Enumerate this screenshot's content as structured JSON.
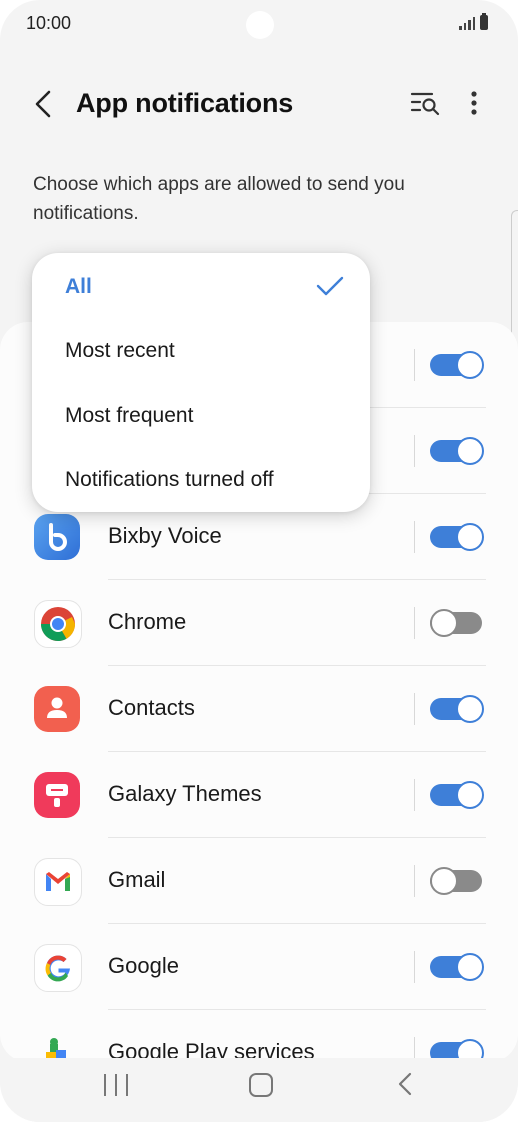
{
  "status_bar": {
    "time": "10:00"
  },
  "header": {
    "title": "App notifications"
  },
  "description": "Choose which apps are allowed to send you notifications.",
  "dropdown": {
    "items": [
      {
        "label": "All",
        "selected": true
      },
      {
        "label": "Most recent",
        "selected": false
      },
      {
        "label": "Most frequent",
        "selected": false
      },
      {
        "label": "Notifications turned off",
        "selected": false
      }
    ]
  },
  "apps": [
    {
      "name": "",
      "enabled": true
    },
    {
      "name": "",
      "enabled": true
    },
    {
      "name": "Bixby Voice",
      "enabled": true,
      "icon": "bixby-voice-icon"
    },
    {
      "name": "Chrome",
      "enabled": false,
      "icon": "chrome-icon"
    },
    {
      "name": "Contacts",
      "enabled": true,
      "icon": "contacts-icon"
    },
    {
      "name": "Galaxy Themes",
      "enabled": true,
      "icon": "galaxy-themes-icon"
    },
    {
      "name": "Gmail",
      "enabled": false,
      "icon": "gmail-icon"
    },
    {
      "name": "Google",
      "enabled": true,
      "icon": "google-icon"
    },
    {
      "name": "Google Play services",
      "enabled": true,
      "icon": "google-play-services-icon"
    }
  ],
  "colors": {
    "accent": "#3e7fd8",
    "toggle_off": "#8a8a8a"
  }
}
